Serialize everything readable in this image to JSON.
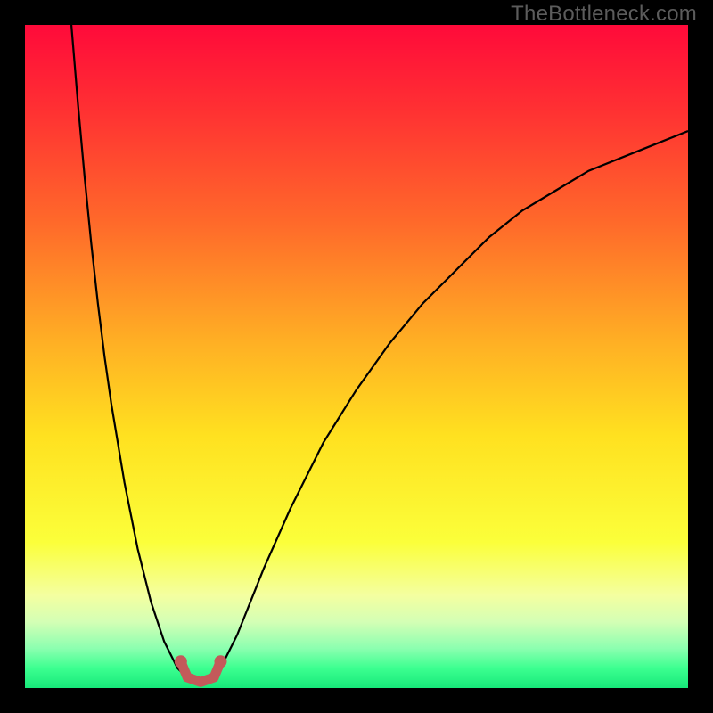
{
  "watermark": "TheBottleneck.com",
  "chart_data": {
    "type": "line",
    "title": "",
    "xlabel": "",
    "ylabel": "",
    "xlim": [
      0,
      100
    ],
    "ylim": [
      0,
      100
    ],
    "grid": false,
    "legend": false,
    "gradient_stops": [
      {
        "offset": 0,
        "color": "#ff0a3a"
      },
      {
        "offset": 0.12,
        "color": "#ff2e33"
      },
      {
        "offset": 0.3,
        "color": "#ff6a2a"
      },
      {
        "offset": 0.48,
        "color": "#ffb024"
      },
      {
        "offset": 0.62,
        "color": "#ffe120"
      },
      {
        "offset": 0.78,
        "color": "#fbff3a"
      },
      {
        "offset": 0.86,
        "color": "#f4ffa0"
      },
      {
        "offset": 0.9,
        "color": "#d4ffb5"
      },
      {
        "offset": 0.94,
        "color": "#8cffb0"
      },
      {
        "offset": 0.97,
        "color": "#3cff90"
      },
      {
        "offset": 1.0,
        "color": "#17e87a"
      }
    ],
    "series": [
      {
        "name": "left-curve",
        "stroke": "#000000",
        "stroke_width": 2.2,
        "x": [
          7,
          8,
          9,
          10,
          11,
          12,
          13,
          14,
          15,
          16,
          17,
          18,
          19,
          20,
          21,
          22,
          23,
          24
        ],
        "y": [
          100,
          88,
          77,
          67,
          58,
          50,
          43,
          37,
          31,
          26,
          21,
          17,
          13,
          10,
          7,
          5,
          3,
          2
        ]
      },
      {
        "name": "right-curve",
        "stroke": "#000000",
        "stroke_width": 2.2,
        "x": [
          29,
          30,
          32,
          34,
          36,
          40,
          45,
          50,
          55,
          60,
          65,
          70,
          75,
          80,
          85,
          90,
          95,
          100
        ],
        "y": [
          2,
          4,
          8,
          13,
          18,
          27,
          37,
          45,
          52,
          58,
          63,
          68,
          72,
          75,
          78,
          80,
          82,
          84
        ]
      },
      {
        "name": "marker-segment",
        "stroke": "#c35a5a",
        "stroke_width": 11,
        "linecap": "round",
        "x": [
          23.5,
          24.5,
          26.5,
          28.5,
          29.5
        ],
        "y": [
          4.0,
          1.6,
          0.9,
          1.6,
          4.0
        ]
      }
    ],
    "marker_dots": {
      "color": "#c35a5a",
      "r": 7,
      "points": [
        {
          "x": 23.5,
          "y": 4.0
        },
        {
          "x": 29.5,
          "y": 4.0
        }
      ]
    }
  }
}
